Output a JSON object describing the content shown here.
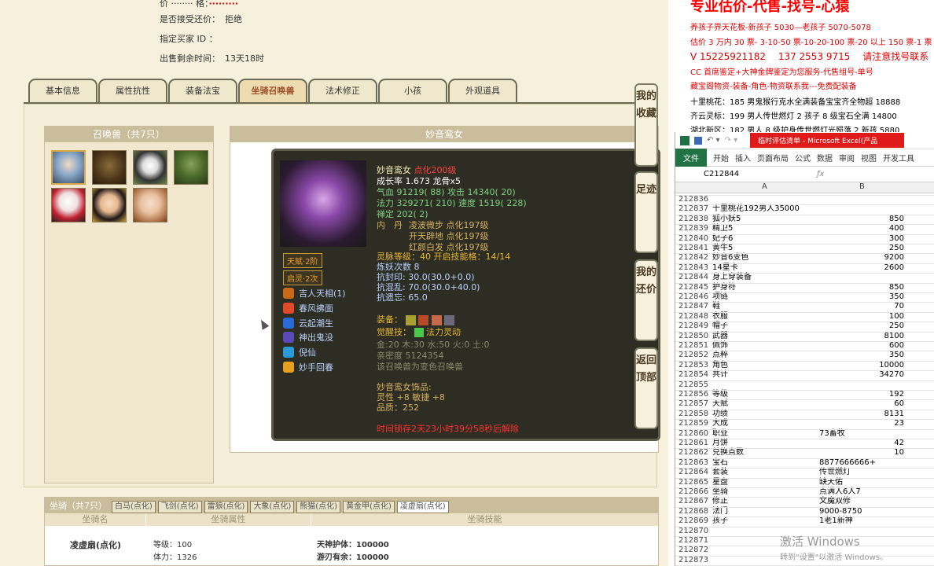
{
  "left": {
    "info": [
      {
        "label": "是否接受还价：",
        "value": "拒绝"
      },
      {
        "label": "指定买家 ID ：",
        "value": ""
      },
      {
        "label": "出售剩余时间：",
        "value": "13天18时"
      }
    ],
    "tabs": [
      "基本信息",
      "属性抗性",
      "装备法宝",
      "坐骑召唤兽",
      "法术修正",
      "小孩",
      "外观道具"
    ],
    "active_tab": 3,
    "pets_title": "召唤兽（共7只）",
    "detail_title": "妙音鸾女",
    "card": {
      "name": "妙音鸾女",
      "name_tag": "点化200级",
      "growth": "成长率 1.673 龙骨x5",
      "hp": "气血 91219( 88) 攻击 14340( 20)",
      "mp": "法力 329271( 210) 速度 1519( 228)",
      "ding": "禅定 202( 2)",
      "neidan_label": "内　丹",
      "neidan": [
        "凌波微步 点化197级",
        "开天辟地 点化197级",
        "红颜白发 点化197级"
      ],
      "talent_badge": "天赋·2阶",
      "qifa_badge": "启灵·2次",
      "skills": [
        "吉人天相(1)",
        "春风拂面",
        "云起潮生",
        "神出鬼没",
        "倪仙",
        "妙手回春"
      ],
      "lingyun": "灵脉等级：40 开启技能格：14/14",
      "lianyao": "炼妖次数 8",
      "resist": [
        "抗封印: 30.0(30.0+0.0)",
        "抗混乱: 70.0(30.0+40.0)",
        "抗遗忘: 65.0"
      ],
      "equip_label": "装备：",
      "awaken_label": "觉醒技：",
      "awaken_skill": "法力灵动",
      "elements": "金:20 木:30 水:50 火:0 土:0",
      "intimacy": "亲密度 5124354",
      "note": "该召唤兽为变色召唤兽",
      "accessory_title": "妙音鸾女饰品:",
      "accessory_stats": "灵性 +8 敏捷 +8",
      "quality": "品质：252",
      "time_limit": "时间锁存2天23小时39分58秒后解除"
    },
    "side_buttons": [
      "我的收藏",
      "足迹",
      "我的还价",
      "返回顶部"
    ],
    "mount": {
      "title": "坐骑（共7只）",
      "tabs": [
        "白马(点化)",
        "飞剑(点化)",
        "雷狼(点化)",
        "大象(点化)",
        "熊猫(点化)",
        "黄金甲(点化)",
        "凌虚扇(点化)"
      ],
      "headers": [
        "坐骑名",
        "坐骑属性",
        "坐骑技能"
      ],
      "name": "凌虚扇(点化)",
      "attrs": [
        "等级：100",
        "体力：1326"
      ],
      "skills": [
        "天神护体：100000",
        "游刃有余：100000"
      ]
    }
  },
  "right": {
    "headline": "专业估价-代售-找号-心猿",
    "ads": [
      {
        "text": "养孩子界天花板-新孩子 5030—老孩子 5070-5078",
        "color": "#e00000"
      },
      {
        "text": "估价 3 万内 30 票- 3-10-50 票-10-20-100 票-20 以上 150 票-1 票 1",
        "color": "#e00000"
      },
      {
        "text": "V 15225921182 　137 2553 9715 　请注意找号联系",
        "color": "#e00000"
      },
      {
        "text": "CC 首席鉴定+大神金牌鉴定为您服务-代售组号-单号",
        "color": "#e00000"
      },
      {
        "text": "藏宝阁物资-装备-角色-物资联系我---免费配装备",
        "color": "#e00000"
      },
      {
        "text": "十里桃花：185 男鬼猴行克水全满装备宝宝齐全物超 18888",
        "color": "#000000"
      },
      {
        "text": "齐云灵标：199 男人传世燃灯 2 孩子 8 级宝石全满 14800",
        "color": "#000000"
      },
      {
        "text": "湖北新区：182 男人 8 级护身传世燃灯光殒落 2 新孩 5880",
        "color": "#000000"
      }
    ],
    "excel": {
      "title": "临时评估清单 - Microsoft Excel(产品",
      "menu": [
        "文件",
        "开始",
        "插入",
        "页面布局",
        "公式",
        "数据",
        "审阅",
        "视图",
        "开发工具"
      ],
      "cell_ref": "C212844",
      "col_a": "A",
      "col_b": "B",
      "rows": [
        {
          "n": "212836",
          "a": "",
          "b": ""
        },
        {
          "n": "212837",
          "a": "十里桃花192男人35000",
          "b": ""
        },
        {
          "n": "212838",
          "a": "狐小妖5",
          "b": "850"
        },
        {
          "n": "212839",
          "a": "精卫5",
          "b": "400"
        },
        {
          "n": "212840",
          "a": "妃子6",
          "b": "300"
        },
        {
          "n": "212841",
          "a": "黄牛5",
          "b": "250"
        },
        {
          "n": "212842",
          "a": "妙音6变色",
          "b": "9200"
        },
        {
          "n": "212843",
          "a": "14星卡",
          "b": "2600"
        },
        {
          "n": "212844",
          "a": "身上穿装备",
          "b": ""
        },
        {
          "n": "212845",
          "a": "护身符",
          "b": "850"
        },
        {
          "n": "212846",
          "a": "项链",
          "b": "350"
        },
        {
          "n": "212847",
          "a": "鞋",
          "b": "70"
        },
        {
          "n": "212848",
          "a": "衣服",
          "b": "100"
        },
        {
          "n": "212849",
          "a": "帽子",
          "b": "250"
        },
        {
          "n": "212850",
          "a": "武器",
          "b": "8100"
        },
        {
          "n": "212851",
          "a": "佩饰",
          "b": "600"
        },
        {
          "n": "212852",
          "a": "点粹",
          "b": "350"
        },
        {
          "n": "212853",
          "a": "角色",
          "b": "10000"
        },
        {
          "n": "212854",
          "a": "共计",
          "b": "34270"
        },
        {
          "n": "212855",
          "a": "",
          "b": ""
        },
        {
          "n": "212856",
          "a": "等级",
          "b": "192"
        },
        {
          "n": "212857",
          "a": "天赋",
          "b": "60"
        },
        {
          "n": "212858",
          "a": "功绩",
          "b": "8131"
        },
        {
          "n": "212859",
          "a": "大成",
          "b": "23"
        },
        {
          "n": "212860",
          "a": "职业",
          "b": "73畜牧",
          "left": true
        },
        {
          "n": "212861",
          "a": "月饼",
          "b": "42"
        },
        {
          "n": "212862",
          "a": "兑换点数",
          "b": "10"
        },
        {
          "n": "212863",
          "a": "宝石",
          "b": "8877666666+",
          "left": true
        },
        {
          "n": "212864",
          "a": "套装",
          "b": "传世燃灯",
          "left": true
        },
        {
          "n": "212865",
          "a": "星盘",
          "b": "缺天佑",
          "left": true
        },
        {
          "n": "212866",
          "a": "坐骑",
          "b": "点满人6人7",
          "left": true
        },
        {
          "n": "212867",
          "a": "修正",
          "b": "文魔双修",
          "left": true
        },
        {
          "n": "212868",
          "a": "法门",
          "b": "9000-8750",
          "left": true
        },
        {
          "n": "212869",
          "a": "孩子",
          "b": "1老1新神",
          "left": true
        },
        {
          "n": "212870",
          "a": "",
          "b": ""
        },
        {
          "n": "212871",
          "a": "",
          "b": ""
        },
        {
          "n": "212872",
          "a": "",
          "b": ""
        },
        {
          "n": "212873",
          "a": "",
          "b": ""
        }
      ]
    },
    "watermark": "激活 Windows",
    "watermark_sub": "转到\"设置\"以激活 Windows。"
  }
}
